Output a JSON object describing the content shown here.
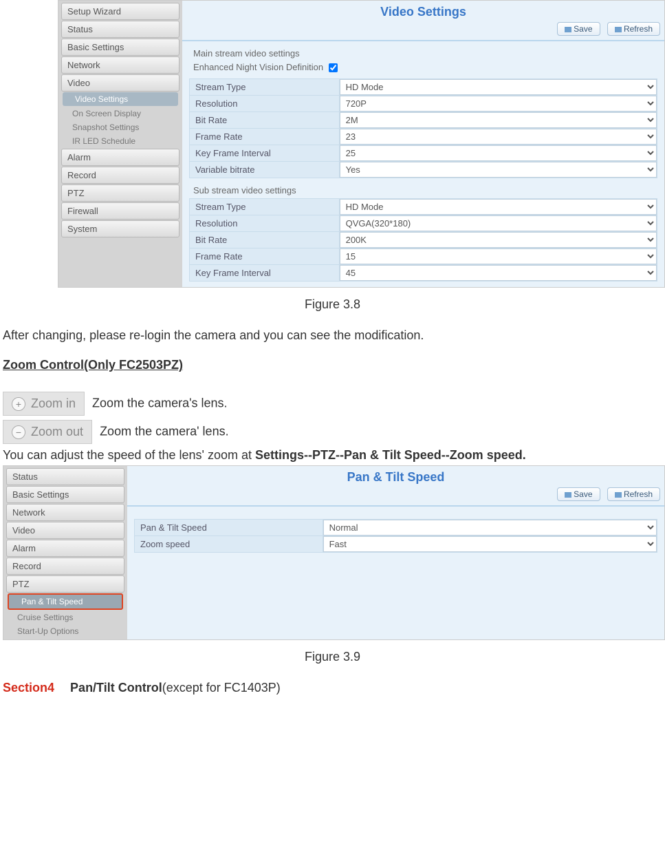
{
  "figure8": {
    "title": "Video Settings",
    "save": "Save",
    "refresh": "Refresh",
    "sidebar": {
      "setup_wizard": "Setup Wizard",
      "status": "Status",
      "basic_settings": "Basic Settings",
      "network": "Network",
      "video": "Video",
      "video_sub": {
        "video_settings": "Video Settings",
        "osd": "On Screen Display",
        "snapshot": "Snapshot Settings",
        "ir_led": "IR LED Schedule"
      },
      "alarm": "Alarm",
      "record": "Record",
      "ptz": "PTZ",
      "firewall": "Firewall",
      "system": "System"
    },
    "main_label": "Main stream video settings",
    "envd_label": "Enhanced Night Vision Definition",
    "rows_main": {
      "stream_type": {
        "label": "Stream Type",
        "value": "HD Mode"
      },
      "resolution": {
        "label": "Resolution",
        "value": "720P"
      },
      "bit_rate": {
        "label": "Bit Rate",
        "value": "2M"
      },
      "frame_rate": {
        "label": "Frame Rate",
        "value": "23"
      },
      "key_frame": {
        "label": "Key Frame Interval",
        "value": "25"
      },
      "var_bitrate": {
        "label": "Variable bitrate",
        "value": "Yes"
      }
    },
    "sub_label": "Sub stream video settings",
    "rows_sub": {
      "stream_type": {
        "label": "Stream Type",
        "value": "HD Mode"
      },
      "resolution": {
        "label": "Resolution",
        "value": "QVGA(320*180)"
      },
      "bit_rate": {
        "label": "Bit Rate",
        "value": "200K"
      },
      "frame_rate": {
        "label": "Frame Rate",
        "value": "15"
      },
      "key_frame": {
        "label": "Key Frame Interval",
        "value": "45"
      }
    },
    "caption": "Figure 3.8"
  },
  "text_after_fig8": "After changing, please re-login the camera and you can see the modification.",
  "zoom_heading": "Zoom Control(Only FC2503PZ)",
  "zoom_in": {
    "btn": "Zoom in",
    "desc": "Zoom the camera's lens."
  },
  "zoom_out": {
    "btn": "Zoom out",
    "desc": "Zoom the camera' lens."
  },
  "zoom_path_prefix": "You can adjust the speed of the lens' zoom at ",
  "zoom_path_bold": "Settings--PTZ--Pan & Tilt Speed--Zoom speed.",
  "figure9": {
    "title": "Pan & Tilt Speed",
    "save": "Save",
    "refresh": "Refresh",
    "sidebar": {
      "status": "Status",
      "basic_settings": "Basic Settings",
      "network": "Network",
      "video": "Video",
      "alarm": "Alarm",
      "record": "Record",
      "ptz": "PTZ",
      "ptz_sub": {
        "pan_tilt_speed": "Pan & Tilt Speed",
        "cruise": "Cruise Settings",
        "startup": "Start-Up Options"
      }
    },
    "rows": {
      "pan_tilt": {
        "label": "Pan & Tilt Speed",
        "value": "Normal"
      },
      "zoom": {
        "label": "Zoom speed",
        "value": "Fast"
      }
    },
    "caption": "Figure 3.9"
  },
  "section4": {
    "label": "Section4",
    "bold": "Pan/Tilt Control",
    "rest": "(except for FC1403P)"
  }
}
